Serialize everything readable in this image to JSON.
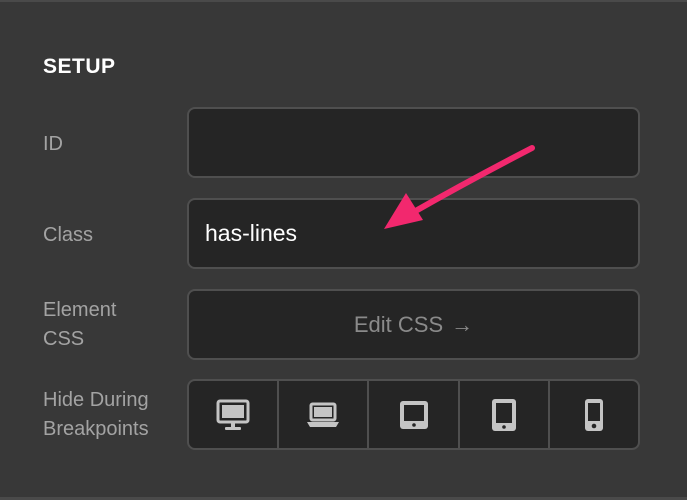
{
  "setup": {
    "title": "SETUP",
    "id_label": "ID",
    "id_value": "",
    "class_label": "Class",
    "class_value": "has-lines",
    "element_css_label_line1": "Element",
    "element_css_label_line2": "CSS",
    "edit_css_label": "Edit CSS",
    "edit_css_arrow": "→",
    "hide_label_line1": "Hide During",
    "hide_label_line2": "Breakpoints",
    "breakpoints": [
      {
        "icon": "desktop-icon"
      },
      {
        "icon": "laptop-icon"
      },
      {
        "icon": "tablet-landscape-icon"
      },
      {
        "icon": "tablet-portrait-icon"
      },
      {
        "icon": "mobile-icon"
      }
    ]
  },
  "annotation": {
    "arrow_color": "#f2286e"
  }
}
